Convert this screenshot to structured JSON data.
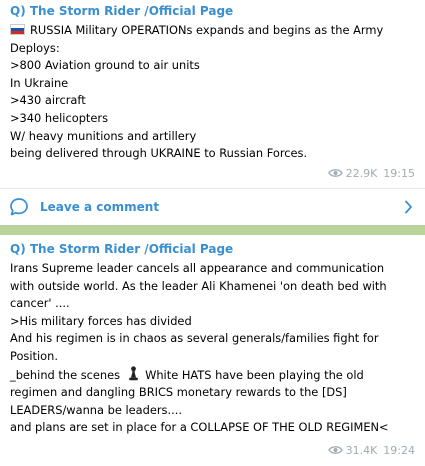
{
  "messages": [
    {
      "author": "Q) The Storm Rider /Official Page",
      "flag_icon": "russia-flag-icon",
      "lines": [
        "RUSSIA Military OPERATIONs expands and begins as the Army",
        "Deploys:",
        ">800 Aviation ground to air units",
        "In Ukraine",
        ">430 aircraft",
        ">340 helicopters",
        "W/ heavy munitions and artillery",
        "being delivered through UKRAINE to Russian Forces."
      ],
      "views": "22.9K",
      "time": "19:15",
      "comment_label": "Leave a comment"
    },
    {
      "author": "Q) The Storm Rider /Official Page",
      "lines": [
        "Irans Supreme leader cancels all appearance and communication",
        "with outside world. As the leader Ali Khamenei 'on death bed with",
        "cancer' ....",
        ">His military forces has divided",
        "And his regimen is in chaos as several generals/families fight for",
        "Position.",
        "regimen and dangling BRICS monetary rewards to the [DS]",
        "LEADERS/wanna be leaders....",
        "and plans are set in place for a COLLAPSE OF THE OLD REGIMEN<"
      ],
      "line7_before": "_behind the scenes",
      "line7_after": "White HATS have been playing the old",
      "views": "31.4K",
      "time": "19:24"
    }
  ],
  "colors": {
    "background": "#b9d39b",
    "author": "#3a8fd1",
    "meta": "#a0acb6"
  }
}
